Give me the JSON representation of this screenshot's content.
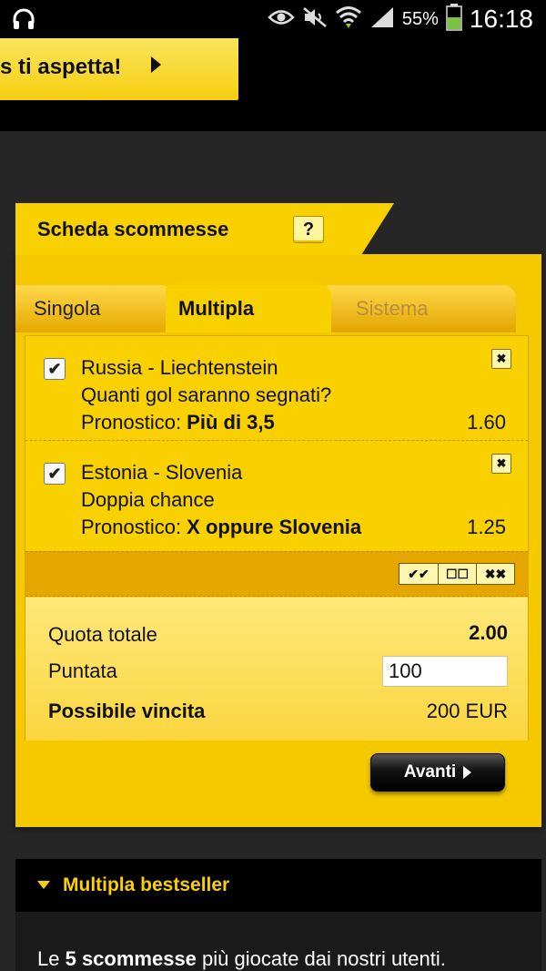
{
  "status_bar": {
    "battery": "55%",
    "time": "16:18",
    "icons": [
      "headphones-icon",
      "eye-icon",
      "mute-icon",
      "wifi-icon",
      "signal-icon",
      "battery-icon"
    ]
  },
  "promo": {
    "label": "s ti aspetta!"
  },
  "bet_slip": {
    "title": "Scheda scommesse",
    "help_label": "?",
    "tabs": [
      {
        "label": "Singola",
        "active": false
      },
      {
        "label": "Multipla",
        "active": true
      },
      {
        "label": "Sistema",
        "active": false,
        "disabled": true
      }
    ],
    "events": [
      {
        "match": "Russia - Liechtenstein",
        "market": "Quanti gol saranno segnati?",
        "prediction_label": "Pronostico: ",
        "prediction": "Più di 3,5",
        "odds": "1.60",
        "checked": true
      },
      {
        "match": "Estonia - Slovenia",
        "market": "Doppia chance",
        "prediction_label": "Pronostico: ",
        "prediction": "X oppure Slovenia",
        "odds": "1.25",
        "checked": true
      }
    ],
    "action_buttons": [
      "✔✔",
      "☐☐",
      "✖✖"
    ],
    "summary": {
      "total_odds_label": "Quota totale",
      "total_odds": "2.00",
      "stake_label": "Puntata",
      "stake": "100",
      "win_label": "Possibile vincita",
      "win": "200 EUR"
    },
    "next_label": "Avanti"
  },
  "bestseller": {
    "title": "Multipla bestseller",
    "desc_pre": "Le ",
    "desc_bold": "5 scommesse",
    "desc_post": " più giocate dai nostri utenti."
  },
  "colors": {
    "accent": "#f9d100",
    "dark": "#000000",
    "background": "#262626"
  }
}
